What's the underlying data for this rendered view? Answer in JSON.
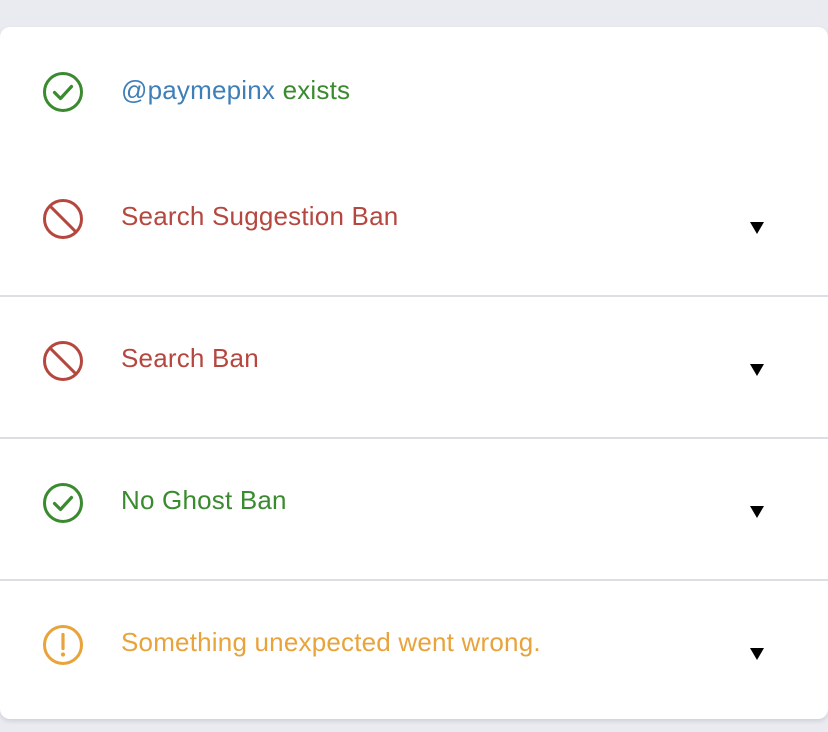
{
  "colors": {
    "success": "#3a8a2f",
    "danger": "#b5473f",
    "warning": "#e8a33a",
    "handle": "#3f7fb8",
    "background": "#e9ebf0",
    "card": "#ffffff"
  },
  "header": {
    "icon": "check-circle-icon",
    "handle": "@paymepinx",
    "suffix": " exists"
  },
  "checks": [
    {
      "icon": "ban-icon",
      "label": "Search Suggestion Ban",
      "status": "danger"
    },
    {
      "icon": "ban-icon",
      "label": "Search Ban",
      "status": "danger"
    },
    {
      "icon": "check-circle-icon",
      "label": "No Ghost Ban",
      "status": "success"
    },
    {
      "icon": "warning-circle-icon",
      "label": "Something unexpected went wrong.",
      "status": "warning"
    }
  ]
}
